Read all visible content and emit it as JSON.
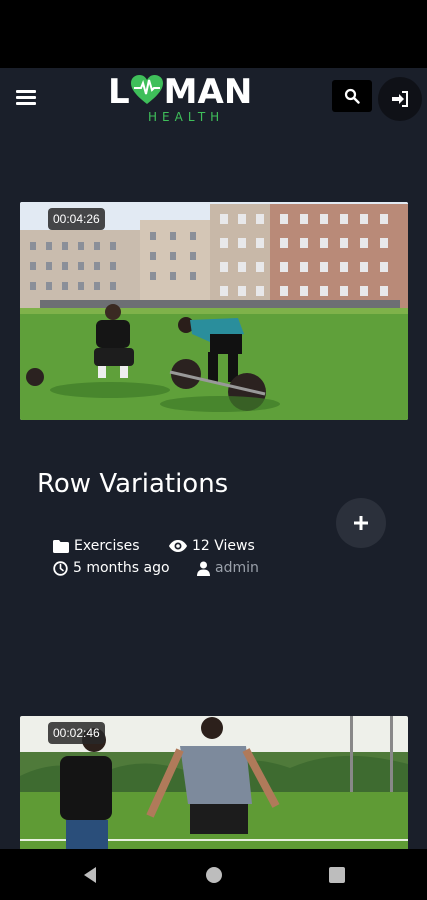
{
  "header": {
    "logo_text_left": "L",
    "logo_text_right": "MAN",
    "logo_subtext": "HEALTH"
  },
  "videos": [
    {
      "duration": "00:04:26",
      "title": "Row Variations",
      "category": "Exercises",
      "views": "12 Views",
      "date": "5 months ago",
      "author": "admin"
    },
    {
      "duration": "00:02:46"
    }
  ],
  "colors": {
    "background": "#1a1f2a",
    "brand_green": "#3fbf5a",
    "button_dark": "#2b303b"
  },
  "icons": {
    "menu": "hamburger-icon",
    "search": "search-icon",
    "login": "sign-in-icon",
    "add": "plus-icon",
    "category": "folder-icon",
    "views": "eye-icon",
    "date": "clock-icon",
    "author": "user-icon"
  }
}
